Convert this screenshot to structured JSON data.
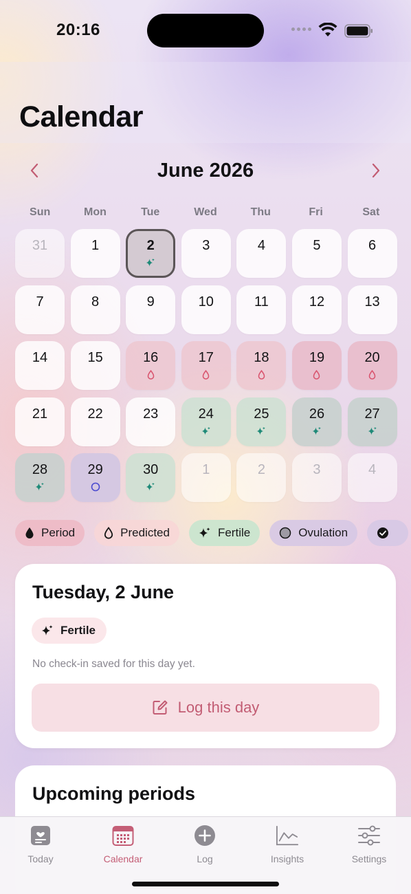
{
  "status_bar": {
    "time": "20:16"
  },
  "page": {
    "title": "Calendar"
  },
  "calendar": {
    "month_label": "June 2026",
    "weekdays": [
      "Sun",
      "Mon",
      "Tue",
      "Wed",
      "Thu",
      "Fri",
      "Sat"
    ],
    "days": [
      {
        "label": "31",
        "state": "outside",
        "mark": ""
      },
      {
        "label": "1",
        "state": "normal",
        "mark": ""
      },
      {
        "label": "2",
        "state": "selected",
        "mark": "sparkle"
      },
      {
        "label": "3",
        "state": "normal",
        "mark": ""
      },
      {
        "label": "4",
        "state": "normal",
        "mark": ""
      },
      {
        "label": "5",
        "state": "normal",
        "mark": ""
      },
      {
        "label": "6",
        "state": "normal",
        "mark": ""
      },
      {
        "label": "7",
        "state": "normal",
        "mark": ""
      },
      {
        "label": "8",
        "state": "normal",
        "mark": ""
      },
      {
        "label": "9",
        "state": "normal",
        "mark": ""
      },
      {
        "label": "10",
        "state": "normal",
        "mark": ""
      },
      {
        "label": "11",
        "state": "normal",
        "mark": ""
      },
      {
        "label": "12",
        "state": "normal",
        "mark": ""
      },
      {
        "label": "13",
        "state": "normal",
        "mark": ""
      },
      {
        "label": "14",
        "state": "normal",
        "mark": ""
      },
      {
        "label": "15",
        "state": "normal",
        "mark": ""
      },
      {
        "label": "16",
        "state": "period",
        "mark": "drop"
      },
      {
        "label": "17",
        "state": "period",
        "mark": "drop"
      },
      {
        "label": "18",
        "state": "period",
        "mark": "drop"
      },
      {
        "label": "19",
        "state": "period2",
        "mark": "drop"
      },
      {
        "label": "20",
        "state": "period2",
        "mark": "drop"
      },
      {
        "label": "21",
        "state": "normal",
        "mark": ""
      },
      {
        "label": "22",
        "state": "normal",
        "mark": ""
      },
      {
        "label": "23",
        "state": "normal",
        "mark": ""
      },
      {
        "label": "24",
        "state": "fertile",
        "mark": "sparkle"
      },
      {
        "label": "25",
        "state": "fertile",
        "mark": "sparkle"
      },
      {
        "label": "26",
        "state": "fertile-gray",
        "mark": "sparkle"
      },
      {
        "label": "27",
        "state": "fertile-gray",
        "mark": "sparkle"
      },
      {
        "label": "28",
        "state": "fertile-gray",
        "mark": "sparkle"
      },
      {
        "label": "29",
        "state": "ovulation",
        "mark": "ring"
      },
      {
        "label": "30",
        "state": "fertile",
        "mark": "sparkle"
      },
      {
        "label": "1",
        "state": "outside",
        "mark": ""
      },
      {
        "label": "2",
        "state": "outside",
        "mark": ""
      },
      {
        "label": "3",
        "state": "outside",
        "mark": ""
      },
      {
        "label": "4",
        "state": "outside",
        "mark": ""
      }
    ]
  },
  "legend": {
    "period": "Period",
    "predicted": "Predicted",
    "fertile": "Fertile",
    "ovulation": "Ovulation"
  },
  "day_card": {
    "title": "Tuesday, 2 June",
    "tag": "Fertile",
    "no_checkin": "No check-in saved for this day yet.",
    "log_button": "Log this day"
  },
  "upcoming": {
    "title": "Upcoming periods"
  },
  "tabs": {
    "today": "Today",
    "calendar": "Calendar",
    "log": "Log",
    "insights": "Insights",
    "settings": "Settings"
  },
  "colors": {
    "accent": "#c45e76",
    "period_drop": "#d9546e",
    "fertile_sparkle": "#1f8a78",
    "ovulation_ring": "#4b4ad0"
  }
}
